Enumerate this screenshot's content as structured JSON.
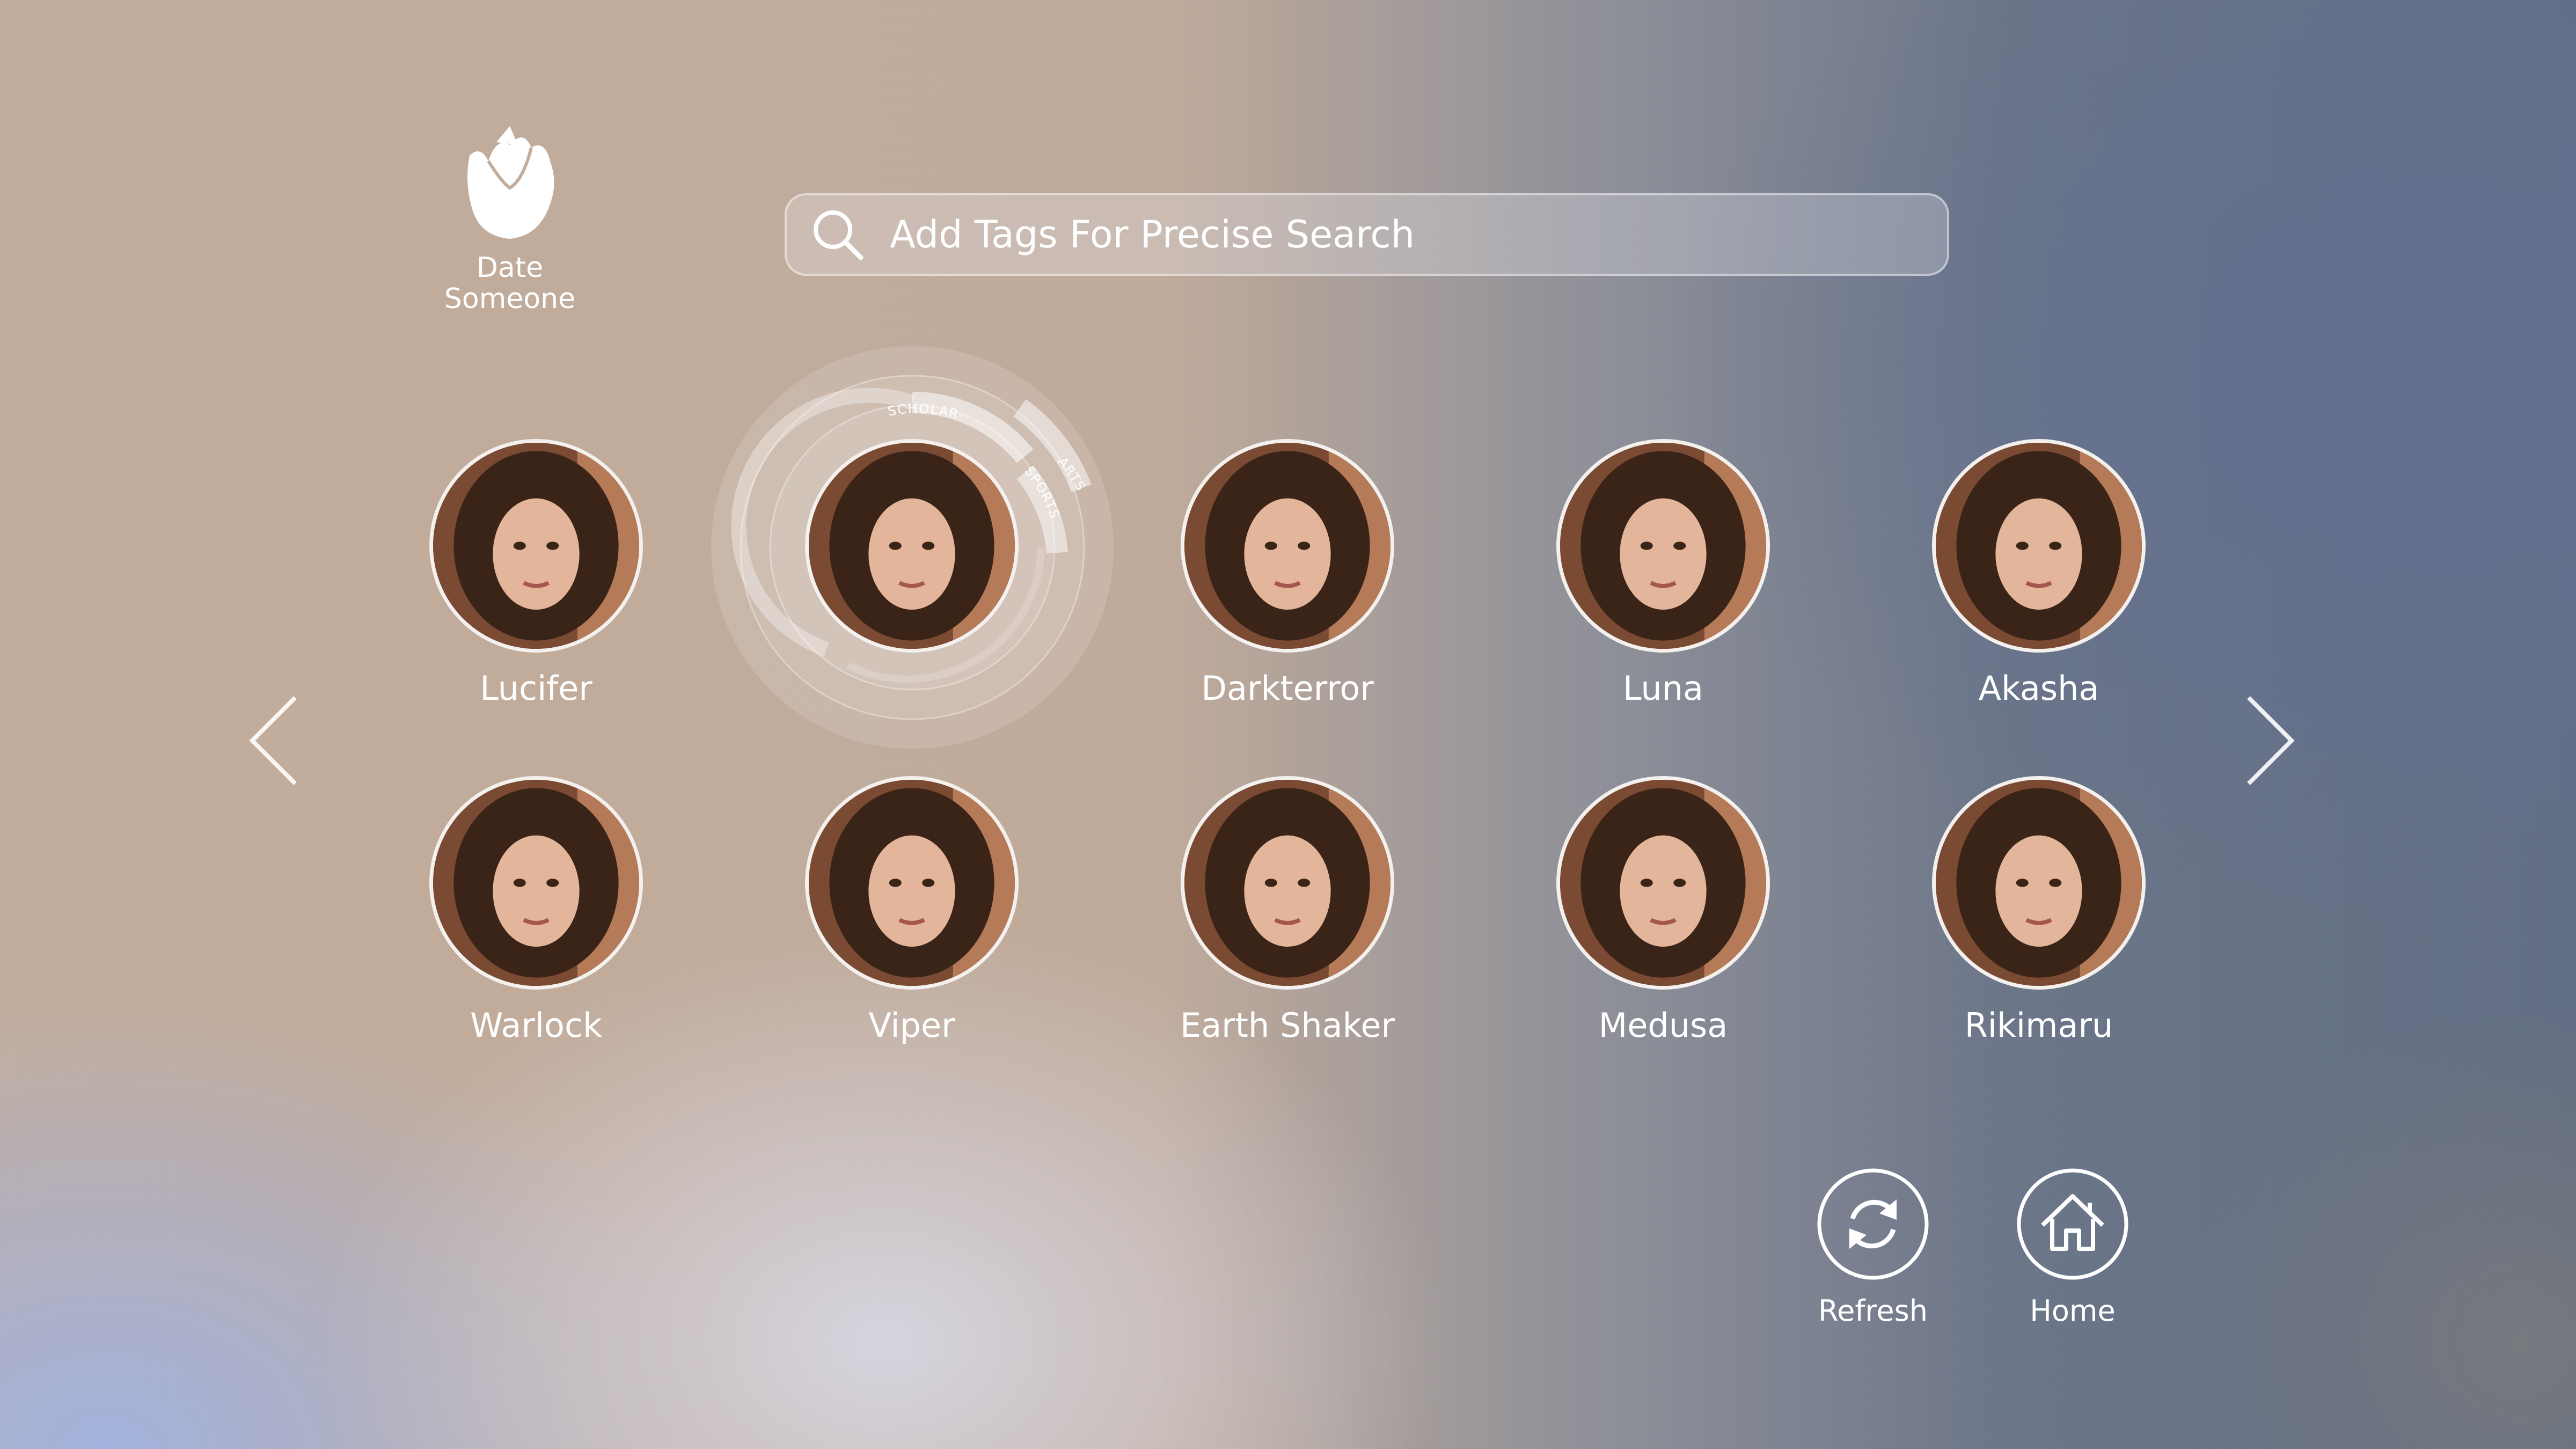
{
  "app": {
    "name": "Date\nSomeone"
  },
  "search": {
    "placeholder": "Add Tags For Precise Search"
  },
  "tag_ring": {
    "tags": [
      "SCHOLAR",
      "ARTS",
      "SPORTS"
    ]
  },
  "profiles": [
    {
      "name": "Lucifer"
    },
    {
      "name": ""
    },
    {
      "name": "Darkterror"
    },
    {
      "name": "Luna"
    },
    {
      "name": "Akasha"
    },
    {
      "name": "Warlock"
    },
    {
      "name": "Viper"
    },
    {
      "name": "Earth Shaker"
    },
    {
      "name": "Medusa"
    },
    {
      "name": "Rikimaru"
    }
  ],
  "actions": {
    "refresh_label": "Refresh",
    "home_label": "Home"
  },
  "icons": {
    "logo": "rose-icon",
    "search": "search-icon",
    "prev": "chevron-left-icon",
    "next": "chevron-right-icon",
    "refresh": "refresh-icon",
    "home": "home-icon"
  }
}
